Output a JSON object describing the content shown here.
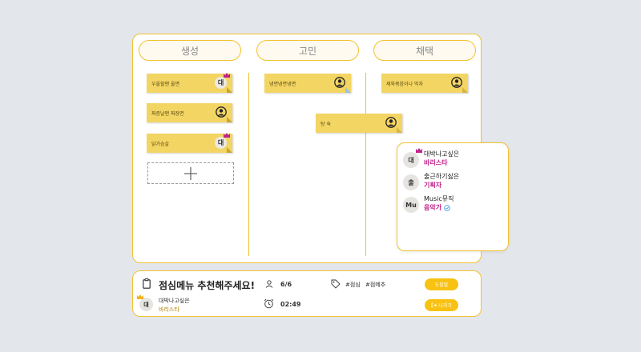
{
  "columns": [
    {
      "title": "생성"
    },
    {
      "title": "고민"
    },
    {
      "title": "채택"
    }
  ],
  "notes": {
    "create": [
      {
        "text": "우울할땐 울면",
        "avatar": "대"
      },
      {
        "text": "짜증날땐 짜장면",
        "avatar": ""
      },
      {
        "text": "닭가슴살",
        "avatar": "대"
      }
    ],
    "worry": [
      {
        "text": "냉면냉면냉면",
        "avatar": ""
      },
      {
        "text": "탕 슉",
        "avatar": ""
      }
    ],
    "adopt": [
      {
        "text": "제육볶음이나 먹자",
        "avatar": ""
      }
    ]
  },
  "members": [
    {
      "avatar": "대",
      "name": "대박나고싶은",
      "role": "바리스타"
    },
    {
      "avatar": "출",
      "name": "출근하기싫은",
      "role": "기획자"
    },
    {
      "avatar": "Mu",
      "name": "Music뮤직",
      "role": "음악가"
    }
  ],
  "meeting": {
    "title": "점심메뉴 추천해주세요!",
    "participants": "6/6",
    "tags": [
      "#점심",
      "#점메추"
    ],
    "timer": "02:49",
    "help_label": "도움말",
    "exit_label": "나가기",
    "host_avatar": "대",
    "host_name": "대박나고싶은",
    "host_role": "바리스타"
  },
  "colors": {
    "accent": "#f2c230",
    "note": "#f3d563",
    "role": "#c0228a",
    "button": "#f8c213"
  }
}
